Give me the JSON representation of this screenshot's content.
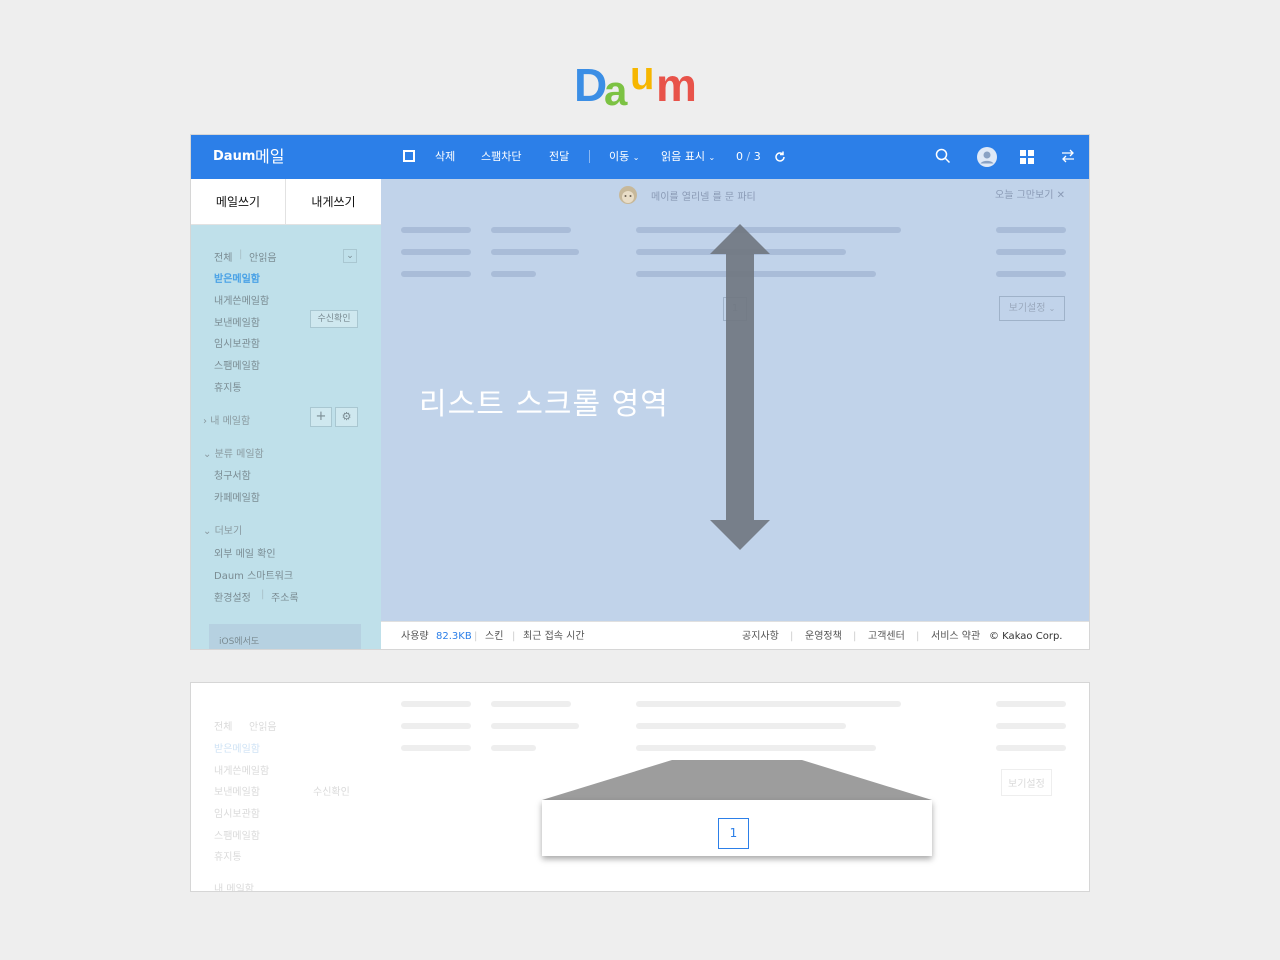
{
  "logo": {
    "letters": [
      "D",
      "a",
      "u",
      "m"
    ],
    "colors": [
      "#3b8ee5",
      "#f6b600",
      "#e8534a",
      "#7cc243"
    ]
  },
  "topbar": {
    "brand": "Daum",
    "title": "메일",
    "delete": "삭제",
    "spam_block": "스팸차단",
    "forward": "전달",
    "move": "이동",
    "mark_read": "읽음 표시",
    "count_selected": "0",
    "count_sep": "/",
    "count_total": "3",
    "bg_color": "#2c7fe8"
  },
  "sidebar": {
    "compose": "메일쓰기",
    "self_compose": "내게쓰기",
    "filter_all": "전체",
    "filter_unread": "안읽음",
    "folders": [
      "받은메일함",
      "내게쓴메일함",
      "보낸메일함",
      "임시보관함",
      "스팸메일함",
      "휴지통"
    ],
    "read_receipt": "수신확인",
    "my_mailbox": "내 메일함",
    "category_mailbox": "분류 메일함",
    "category_items": [
      "청구서함",
      "카페메일함"
    ],
    "more": "더보기",
    "more_items": [
      "외부 메일 확인",
      "Daum 스마트워크"
    ],
    "settings": "환경설정",
    "address_book": "주소록",
    "ios_promo": "iOS에서도"
  },
  "content": {
    "banner": "메이를 열리넬 를 문 파티",
    "hide_today": "오늘 그만보기",
    "scroll_label": "리스트 스크롤 영역",
    "page": "1",
    "view_settings": "보기설정"
  },
  "footer": {
    "usage_label": "사용량",
    "usage_value": "82.3KB",
    "skin": "스킨",
    "last_login": "최근 접속 시간",
    "notice": "공지사항",
    "policy": "운영정책",
    "support": "고객센터",
    "terms": "서비스 약관",
    "copyright": "© Kakao Corp."
  },
  "zoom": {
    "page": "1"
  }
}
